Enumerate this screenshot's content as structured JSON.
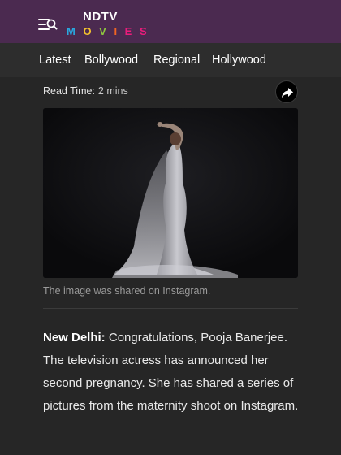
{
  "header": {
    "logo_top": "NDTV",
    "logo_bottom_letters": [
      {
        "char": "M",
        "color": "#29a9e0"
      },
      {
        "char": "O",
        "color": "#f2c12e"
      },
      {
        "char": "V",
        "color": "#8ec63f"
      },
      {
        "char": "I",
        "color": "#f26522"
      },
      {
        "char": "E",
        "color": "#ec1c7c"
      },
      {
        "char": "S",
        "color": "#ec1c7c"
      }
    ],
    "menu_icon": "menu-search-icon",
    "background": "#4b2a50"
  },
  "nav": {
    "items": [
      {
        "label": "Latest"
      },
      {
        "label": "Bollywood"
      },
      {
        "label": "Regional"
      },
      {
        "label": "Hollywood"
      }
    ]
  },
  "article_meta": {
    "read_time_label": "Read Time:",
    "read_time_value": "2 mins",
    "share_icon": "share-icon"
  },
  "image": {
    "caption": "The image was shared on Instagram."
  },
  "article": {
    "dateline": "New Delhi:",
    "intro": " Congratulations, ",
    "person_link": "Pooja Banerjee",
    "body": ". The television actress has announced her second pregnancy. She has shared a series of pictures from the maternity shoot on Instagram."
  }
}
